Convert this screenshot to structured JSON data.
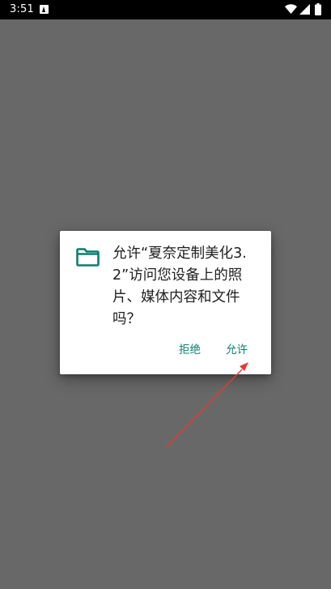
{
  "status_bar": {
    "time": "3:51",
    "notification_icon": "text-a-icon",
    "wifi_icon": "wifi-icon",
    "signal_icon": "signal-icon",
    "battery_icon": "battery-icon"
  },
  "dialog": {
    "icon": "folder-icon",
    "message": "允许“夏奈定制美化3.2”访问您设备上的照片、媒体内容和文件吗？",
    "deny_label": "拒绝",
    "allow_label": "允许"
  },
  "colors": {
    "scrim": "#686868",
    "accent": "#0b7e6e",
    "annotation": "#e53935"
  }
}
